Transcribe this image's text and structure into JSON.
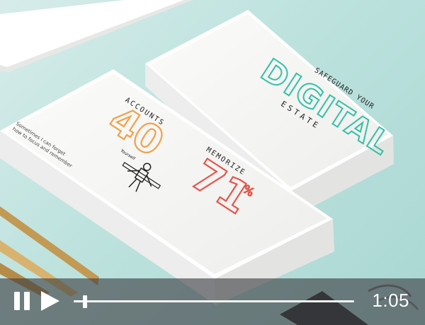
{
  "scene": {
    "card_left": {
      "small_text_lines": [
        "Sometimes I can forget",
        "how to focus and remember"
      ],
      "stat_accounts_number": "40",
      "stat_accounts_label": "ACCOUNTS",
      "figure_label": "Yourself",
      "stat_memorize_number": "71",
      "stat_memorize_suffix": "%",
      "stat_memorize_label": "MEMORIZE"
    },
    "card_right": {
      "tagline": "SAFEGUARD YOUR",
      "title": "DIGITAL",
      "subtitle": "ESTATE"
    }
  },
  "player": {
    "progress": 0.04,
    "time_remaining": "1:05",
    "pause_icon": "pause-icon",
    "play_icon": "play-icon"
  },
  "colors": {
    "accent_teal": "#35c0a6",
    "accent_orange": "#f0a24a",
    "accent_red": "#e2574c"
  }
}
